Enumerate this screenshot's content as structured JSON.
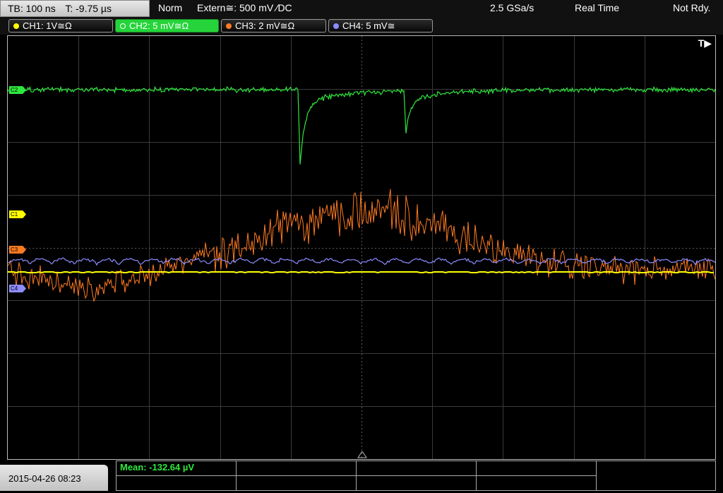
{
  "status_bar": {
    "timebase": "TB: 100 ns",
    "trigger_time": "T: -9.75 µs",
    "trigger_mode": "Norm",
    "trigger_source": "Extern≅: 500 mV ∕DC",
    "sample_rate": "2.5 GSa/s",
    "acquisition_mode": "Real Time",
    "run_state": "Not Rdy."
  },
  "channels": [
    {
      "label": "CH1: 1V≅Ω",
      "color": "#ffff00",
      "marker": "C1",
      "active": false
    },
    {
      "label": "CH2: 5 mV≅Ω",
      "color": "#2ee83d",
      "marker": "C2",
      "active": true
    },
    {
      "label": "CH3: 2 mV≅Ω",
      "color": "#ff7a20",
      "marker": "C3",
      "active": false
    },
    {
      "label": "CH4: 5 mV≅",
      "color": "#8c8cff",
      "marker": "C4",
      "active": false
    }
  ],
  "display": {
    "trigger_marker": "T▶",
    "grid": true,
    "divisions": {
      "x": 10,
      "y": 8
    }
  },
  "measurement": {
    "text": "Mean: -132.64 µV",
    "color": "#2ee83d"
  },
  "timestamp": "2015-04-26 08:23"
}
